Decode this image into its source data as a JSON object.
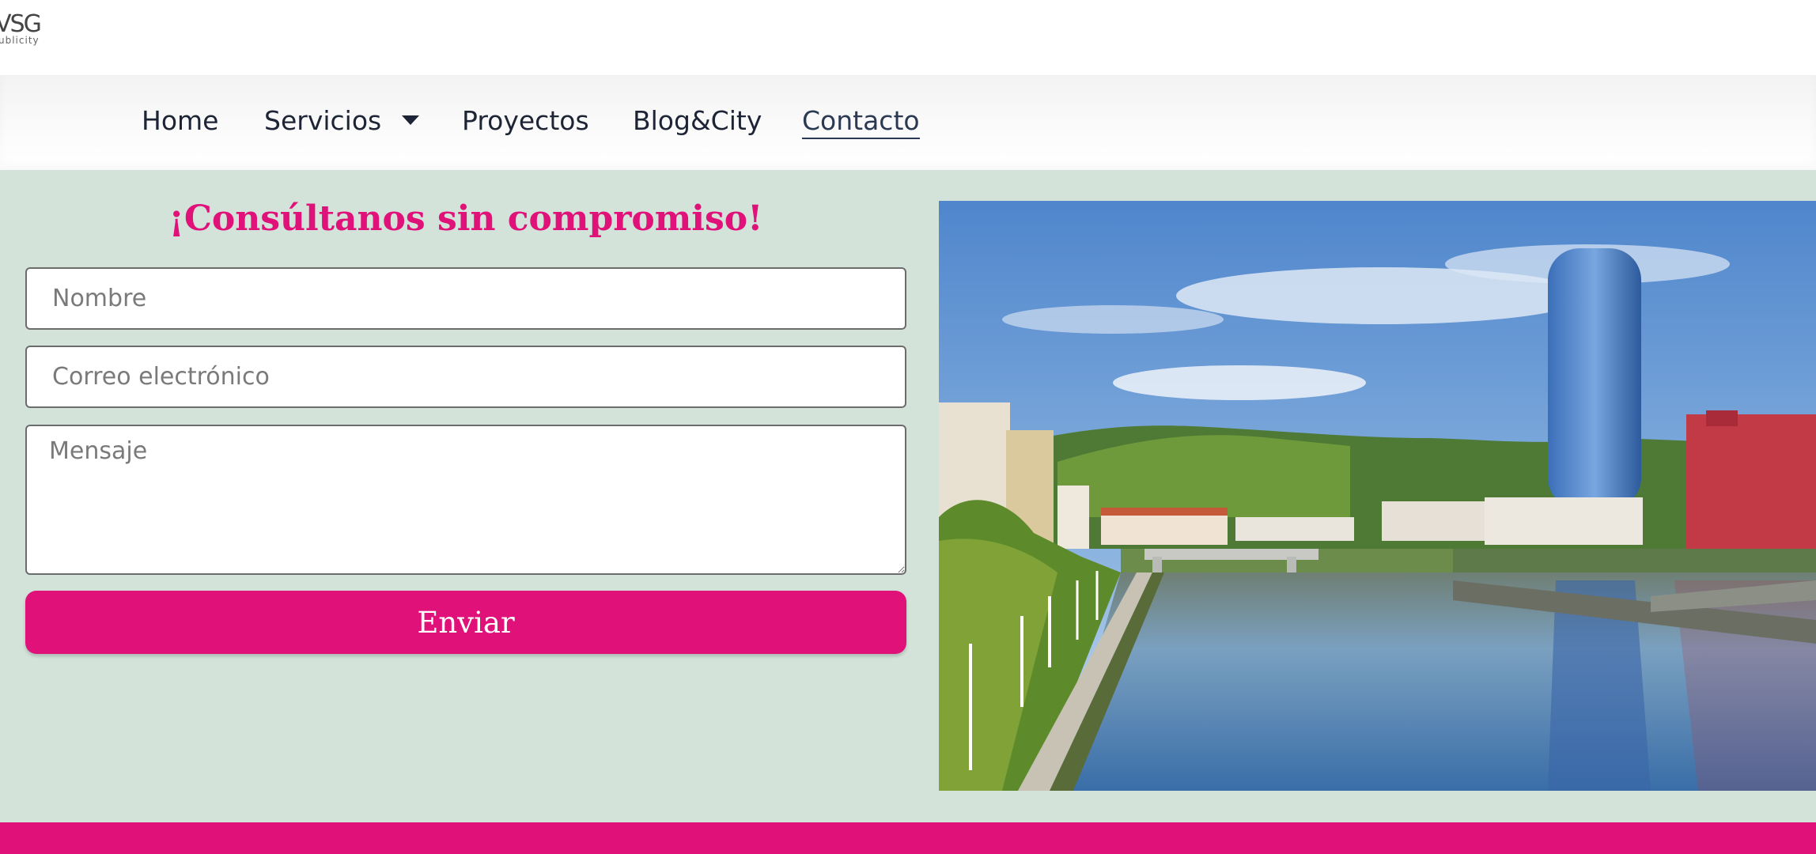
{
  "brand": {
    "logo_text": "VSG",
    "logo_sub": "ublicity"
  },
  "nav": {
    "items": [
      {
        "label": "Home"
      },
      {
        "label": "Servicios",
        "has_dropdown": true
      },
      {
        "label": "Proyectos"
      },
      {
        "label": "Blog&City"
      },
      {
        "label": "Contacto",
        "active": true
      }
    ]
  },
  "form": {
    "heading": "¡Consúltanos sin compromiso!",
    "name_placeholder": "Nombre",
    "email_placeholder": "Correo electrónico",
    "message_placeholder": "Mensaje",
    "submit_label": "Enviar"
  },
  "image": {
    "alt": "Bilbao"
  },
  "colors": {
    "accent": "#e0127a",
    "content_bg": "#d3e3da",
    "nav_text": "#1d2436"
  }
}
